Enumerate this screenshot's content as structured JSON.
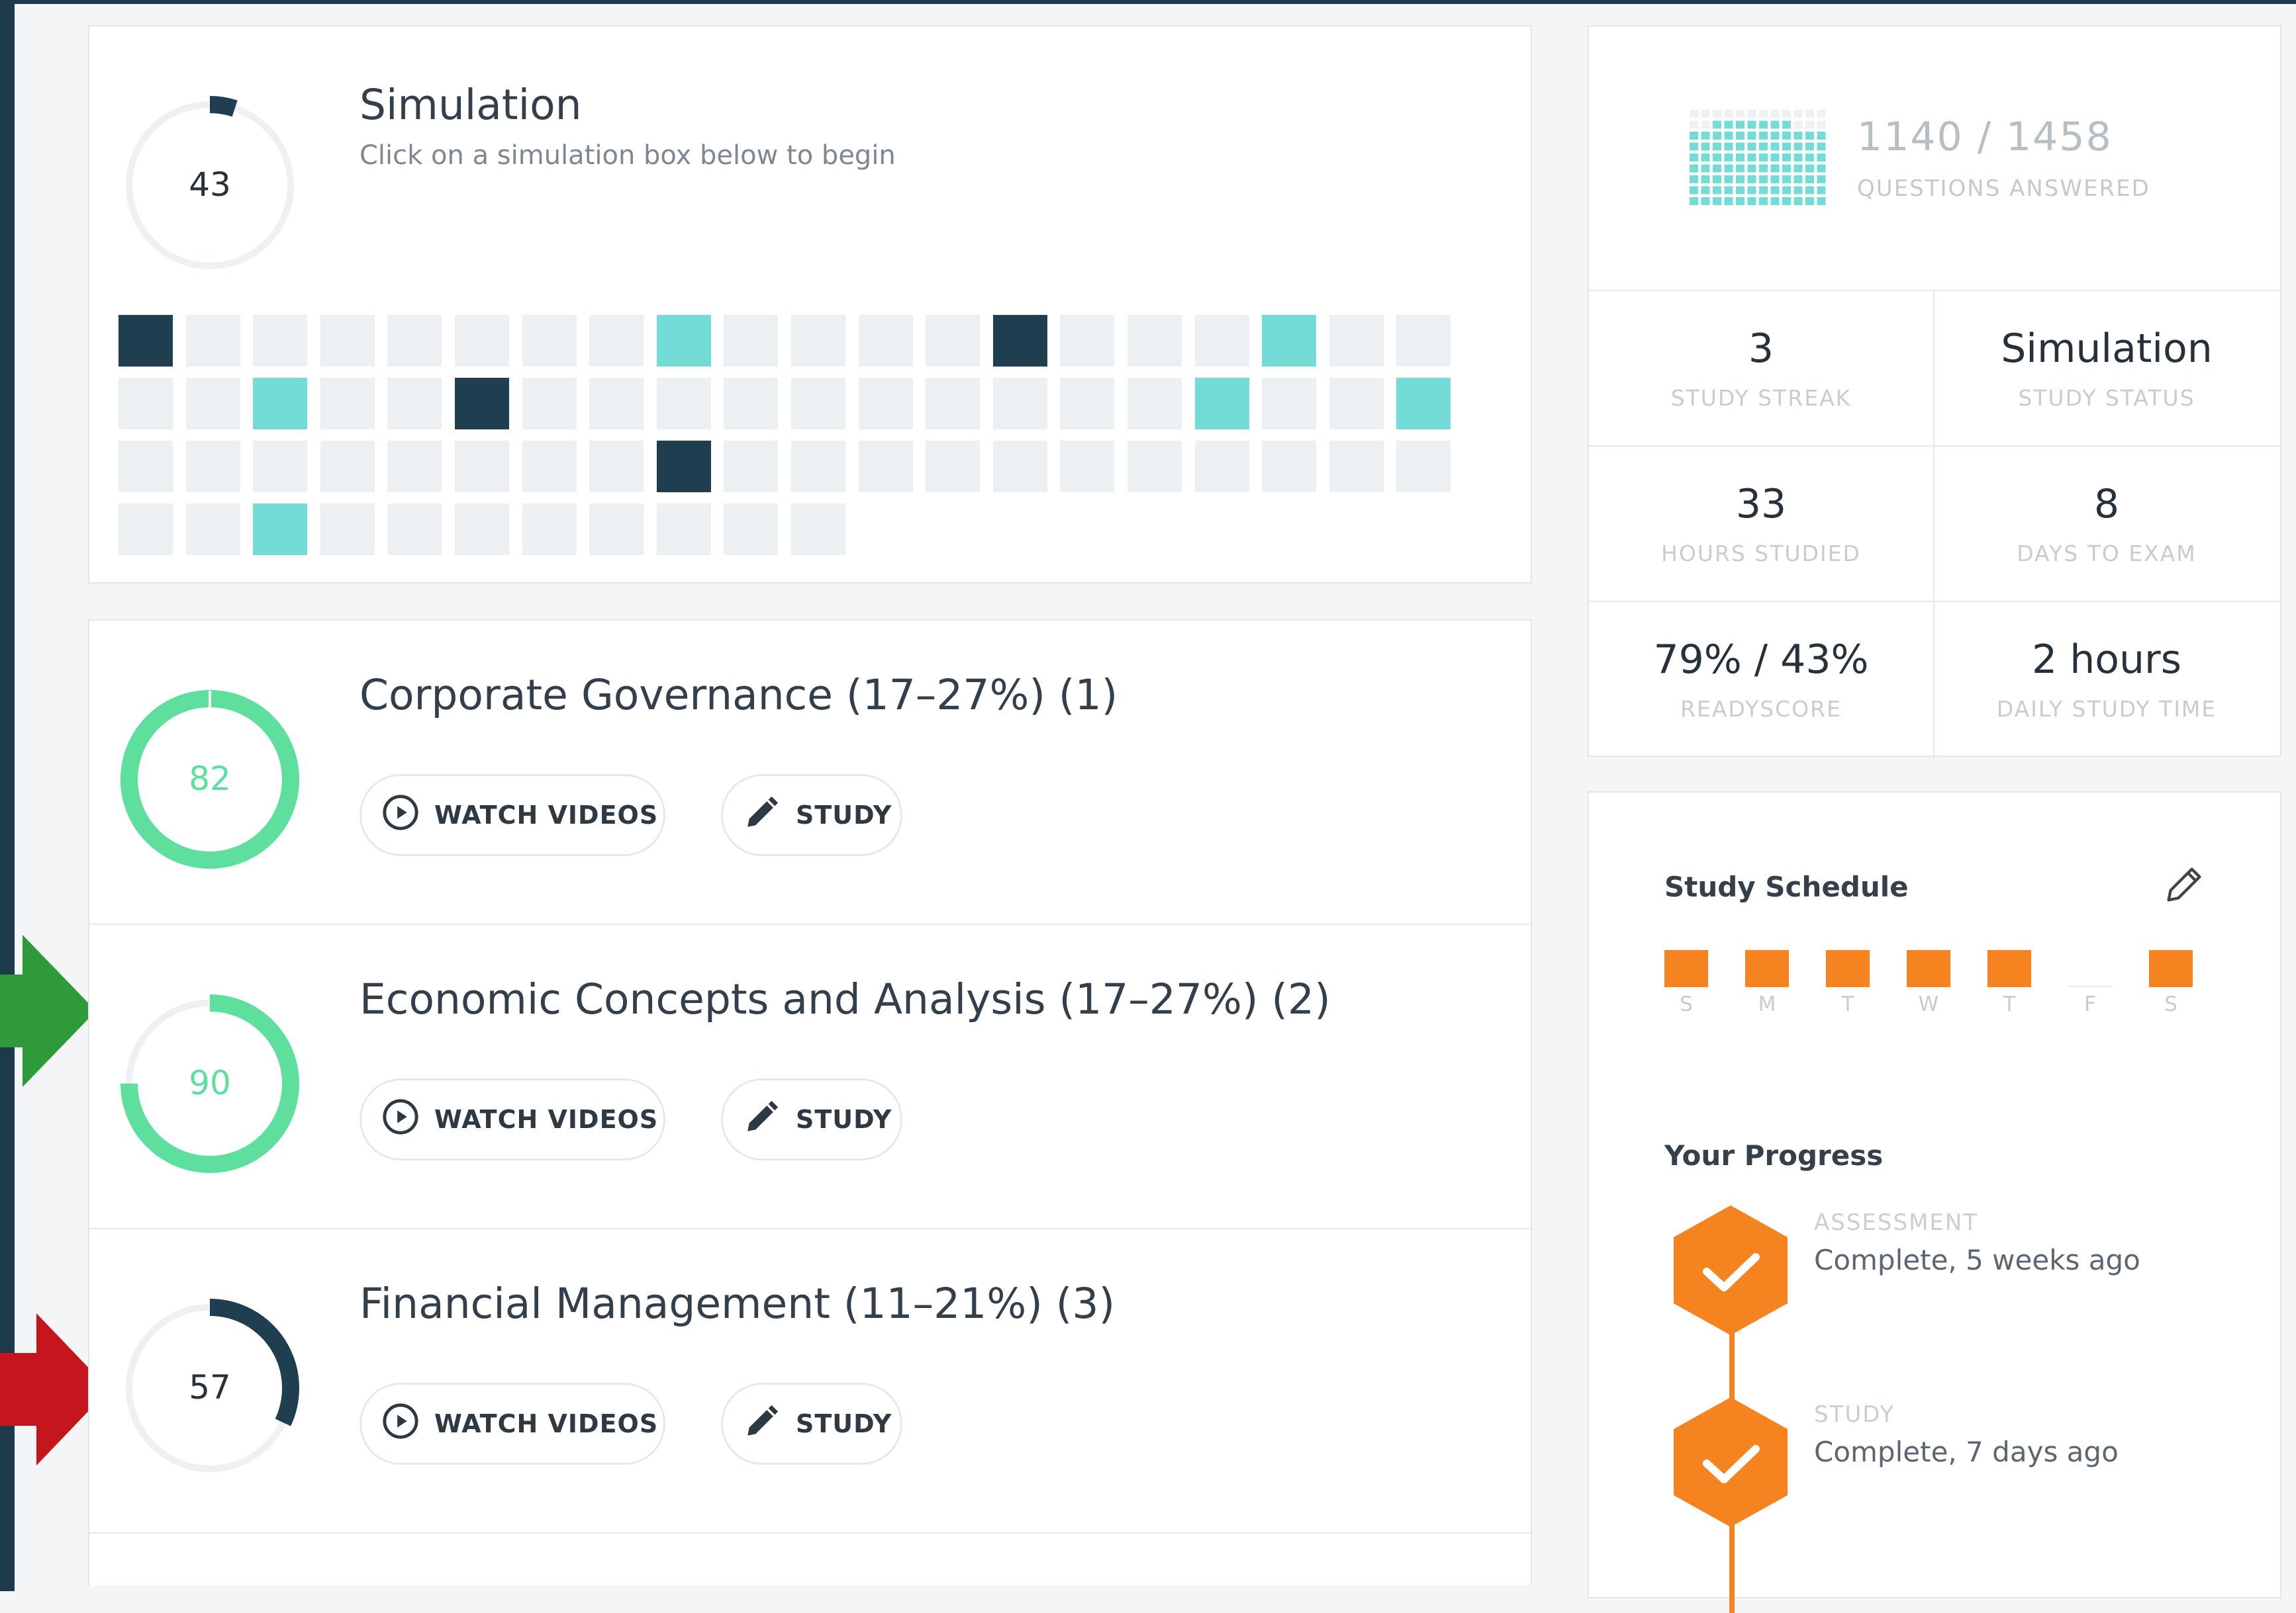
{
  "simulation": {
    "score": "43",
    "score_fraction": 0.05,
    "title": "Simulation",
    "subtitle": "Click on a simulation box below to begin",
    "grid": {
      "rows": [
        [
          "navy",
          "gray",
          "gray",
          "gray",
          "gray",
          "gray",
          "gray",
          "gray",
          "teal",
          "gray",
          "gray",
          "gray",
          "gray",
          "navy",
          "gray",
          "gray",
          "gray",
          "teal",
          "gray",
          "gray"
        ],
        [
          "gray",
          "gray",
          "teal",
          "gray",
          "gray",
          "navy",
          "gray",
          "gray",
          "gray",
          "gray",
          "gray",
          "gray",
          "gray",
          "gray",
          "gray",
          "gray",
          "teal",
          "gray",
          "gray",
          "teal"
        ],
        [
          "gray",
          "gray",
          "gray",
          "gray",
          "gray",
          "gray",
          "gray",
          "gray",
          "navy",
          "gray",
          "gray",
          "gray",
          "gray",
          "gray",
          "gray",
          "gray",
          "gray",
          "gray",
          "gray",
          "gray"
        ],
        [
          "gray",
          "gray",
          "teal",
          "gray",
          "gray",
          "gray",
          "gray",
          "gray",
          "gray",
          "gray",
          "gray"
        ]
      ]
    }
  },
  "topics": [
    {
      "score": "82",
      "score_fraction": 1.0,
      "color": "#5fdf9e",
      "title": "Corporate Governance (17–27%) (1)",
      "watch_label": "WATCH VIDEOS",
      "study_label": "STUDY"
    },
    {
      "score": "90",
      "score_fraction": 0.75,
      "color": "#5fdf9e",
      "title": "Economic Concepts and Analysis (17–27%) (2)",
      "watch_label": "WATCH VIDEOS",
      "study_label": "STUDY"
    },
    {
      "score": "57",
      "score_fraction": 0.32,
      "color": "#1f3f50",
      "title": "Financial Management (11–21%) (3)",
      "watch_label": "WATCH VIDEOS",
      "study_label": "STUDY"
    }
  ],
  "questions": {
    "answered": "1140 / 1458",
    "label": "QUESTIONS ANSWERED"
  },
  "stats": [
    {
      "value": "3",
      "label": "STUDY STREAK"
    },
    {
      "value": "Simulation",
      "label": "STUDY STATUS"
    },
    {
      "value": "33",
      "label": "HOURS STUDIED"
    },
    {
      "value": "8",
      "label": "DAYS TO EXAM"
    },
    {
      "value": "79% / 43%",
      "label": "READYSCORE"
    },
    {
      "value": "2 hours",
      "label": "DAILY STUDY TIME"
    }
  ],
  "schedule": {
    "title": "Study Schedule",
    "days": [
      {
        "label": "S",
        "active": true
      },
      {
        "label": "M",
        "active": true
      },
      {
        "label": "T",
        "active": true
      },
      {
        "label": "W",
        "active": true
      },
      {
        "label": "T",
        "active": true
      },
      {
        "label": "F",
        "active": false
      },
      {
        "label": "S",
        "active": true
      }
    ]
  },
  "progress": {
    "title": "Your Progress",
    "items": [
      {
        "label": "ASSESSMENT",
        "value": "Complete, 5 weeks ago"
      },
      {
        "label": "STUDY",
        "value": "Complete, 7 days ago"
      }
    ]
  },
  "colors": {
    "accent_orange": "#f5831f",
    "ring_green": "#5fdf9e",
    "navy": "#1f3f50",
    "teal": "#74dcd6",
    "arrow_green": "#2e9a3a",
    "arrow_red": "#c4161c"
  }
}
